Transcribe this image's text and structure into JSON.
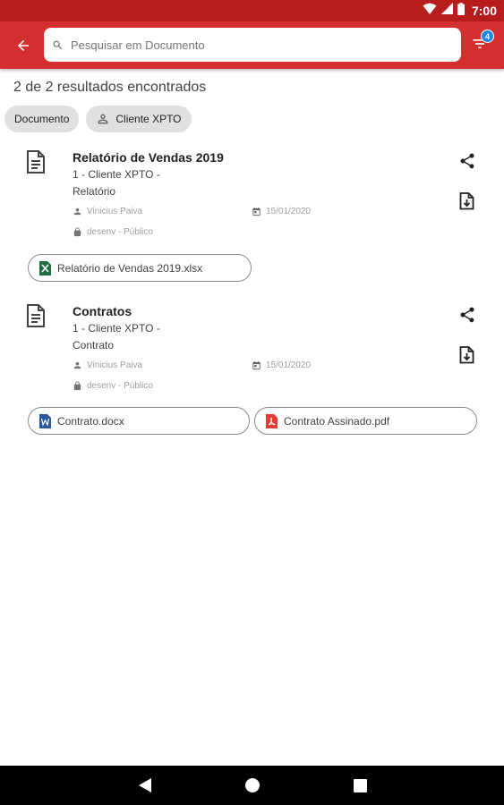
{
  "status_bar": {
    "time": "7:00"
  },
  "app_bar": {
    "search": {
      "placeholder": "Pesquisar em Documento",
      "value": ""
    },
    "filter_badge": "4",
    "accent_color": "#d32f2f"
  },
  "results": {
    "count_text": "2 de 2 resultados encontrados"
  },
  "chips": [
    {
      "label": "Documento",
      "icon": ""
    },
    {
      "label": "Cliente XPTO",
      "icon": "person-outline-icon"
    }
  ],
  "documents": [
    {
      "title": "Relatório de Vendas 2019",
      "line1": "1 - Cliente XPTO -",
      "line2": "Relatório",
      "author": "Vinicius Paiva",
      "date": "15/01/2020",
      "access": "desenv - Público",
      "files": [
        {
          "name": "Relatório de Vendas 2019.xlsx",
          "icon": "excel-icon",
          "color": "#1d6f42"
        }
      ]
    },
    {
      "title": "Contratos",
      "line1": "1 - Cliente XPTO -",
      "line2": "Contrato",
      "author": "Vinicius Paiva",
      "date": "15/01/2020",
      "access": "desenv - Público",
      "files": [
        {
          "name": "Contrato.docx",
          "icon": "word-icon",
          "color": "#2b579a"
        },
        {
          "name": "Contrato Assinado.pdf",
          "icon": "pdf-icon",
          "color": "#e53935"
        }
      ]
    }
  ]
}
